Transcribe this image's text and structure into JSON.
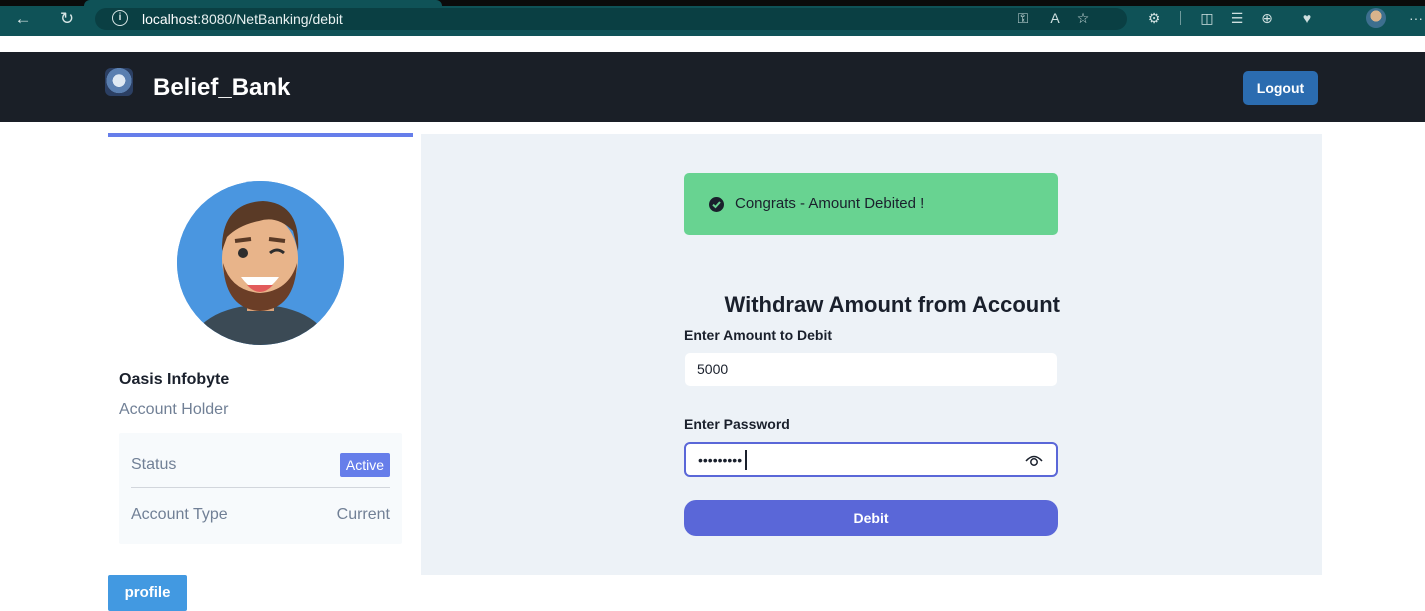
{
  "browser": {
    "url_host": "localhost",
    "url_rest": ":8080/NetBanking/debit",
    "more_label": "···"
  },
  "navbar": {
    "brand": "Belief_Bank",
    "logout_label": "Logout"
  },
  "sidebar": {
    "user_name": "Oasis Infobyte",
    "user_role": "Account Holder",
    "status_label": "Status",
    "status_value": "Active",
    "account_type_label": "Account Type",
    "account_type_value": "Current",
    "profile_button": "profile"
  },
  "main": {
    "alert_text": "Congrats - Amount Debited !",
    "form_title": "Withdraw Amount from Account",
    "amount_label": "Enter Amount to Debit",
    "amount_value": "5000",
    "password_label": "Enter Password",
    "password_mask": "•••••••••",
    "submit_label": "Debit"
  },
  "colors": {
    "navbar_bg": "#1a1f27",
    "accent": "#667eea",
    "button_primary": "#5a67d8",
    "success": "#68d391",
    "logout_bg": "#2b6cb0",
    "profile_bg": "#4299e1"
  }
}
